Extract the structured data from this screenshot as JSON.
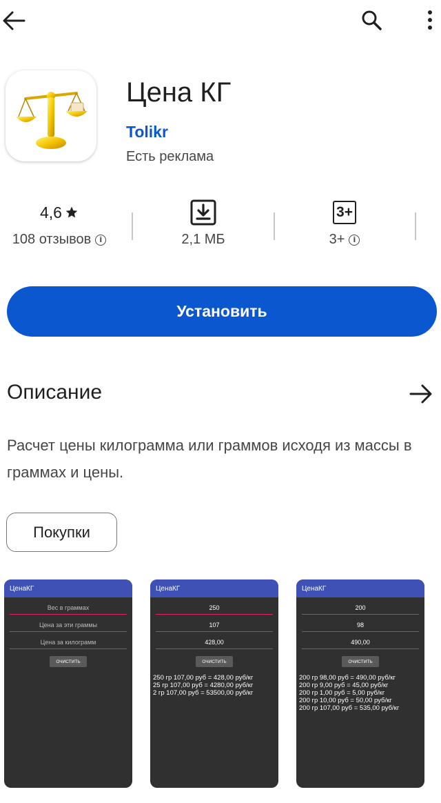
{
  "app": {
    "title": "Цена КГ",
    "developer": "Tolikr",
    "ads_notice": "Есть реклама"
  },
  "stats": {
    "rating": "4,6",
    "reviews": "108 отзывов",
    "size": "2,1 МБ",
    "age_badge": "3+",
    "age_label": "3+"
  },
  "install_label": "Установить",
  "description": {
    "title": "Описание",
    "text": "Расчет цены килограмма или граммов исходя из массы в граммах и цены."
  },
  "chip_label": "Покупки",
  "screenshots": [
    {
      "app_title": "ЦенаКГ",
      "fields": [
        "Вес в граммах",
        "Цена за эти граммы",
        "Цена за килограмм"
      ],
      "button": "ОЧИСТИТЬ",
      "lines": []
    },
    {
      "app_title": "ЦенаКГ",
      "fields": [
        "250",
        "107",
        "428,00"
      ],
      "button": "ОЧИСТИТЬ",
      "lines": [
        "250 гр 107,00 руб = 428,00 руб/кг",
        "25 гр 107,00 руб = 4280,00 руб/кг",
        "2 гр 107,00 руб = 53500,00 руб/кг"
      ]
    },
    {
      "app_title": "ЦенаКГ",
      "fields": [
        "200",
        "98",
        "490,00"
      ],
      "button": "ОЧИСТИТЬ",
      "lines": [
        "200 гр 98,00 руб = 490,00 руб/кг",
        "200 гр 9,00 руб = 45,00 руб/кг",
        "200 гр 1,00 руб = 5,00 руб/кг",
        "200 гр 10,00 руб = 50,00 руб/кг",
        "200 гр 107,00 руб = 535,00 руб/кг"
      ]
    }
  ],
  "colors": {
    "accent": "#0b57d0",
    "screenshot_bar": "#3f51b5"
  },
  "icons": {
    "back": "arrow-back-icon",
    "search": "search-icon",
    "more": "more-vert-icon",
    "star": "star-icon",
    "download": "download-icon",
    "info": "info-icon",
    "arrow_forward": "arrow-forward-icon"
  }
}
